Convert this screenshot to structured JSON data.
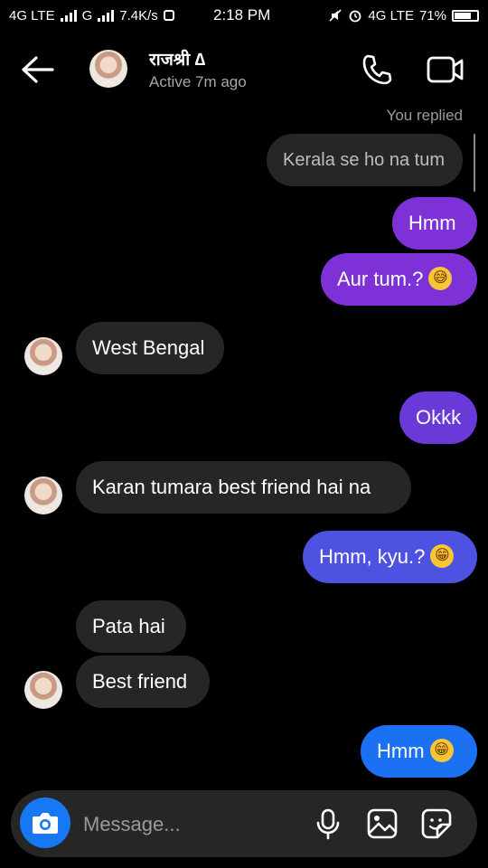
{
  "status_bar": {
    "network1": "4G LTE",
    "network2": "G",
    "speed": "7.4K/s",
    "time": "2:18 PM",
    "network3": "4G LTE",
    "battery": "71%"
  },
  "header": {
    "contact_name": "राजश्री ∆",
    "status": "Active 7m ago",
    "icons": [
      "back-arrow-icon",
      "phone-icon",
      "video-camera-icon"
    ]
  },
  "conversation": {
    "replied_label": "You replied",
    "quoted_message": "Kerala se ho na tum",
    "messages": [
      {
        "from": "me",
        "text": "Hmm",
        "color": "#7d31d6"
      },
      {
        "from": "me",
        "text": "Aur tum.?",
        "emoji": "😅",
        "color": "#7d31d6"
      },
      {
        "from": "them",
        "text": "West Bengal"
      },
      {
        "from": "me",
        "text": "Okkk",
        "color": "#6a3ad8"
      },
      {
        "from": "them",
        "text": "Karan tumara best friend hai na"
      },
      {
        "from": "me",
        "text": "Hmm, kyu.?",
        "emoji": "😁",
        "color": "#4d52e0"
      },
      {
        "from": "them",
        "text": "Pata hai"
      },
      {
        "from": "them",
        "text": "Best friend"
      },
      {
        "from": "me",
        "text": "Hmm",
        "emoji": "😁",
        "color": "#1c71f2"
      }
    ]
  },
  "composer": {
    "placeholder": "Message...",
    "icons": [
      "camera-icon",
      "microphone-icon",
      "gallery-icon",
      "sticker-icon"
    ]
  },
  "colors": {
    "background": "#000000",
    "incoming_bubble": "#262626",
    "accent_blue": "#1877f2",
    "secondary_text": "#a6a6a6"
  }
}
